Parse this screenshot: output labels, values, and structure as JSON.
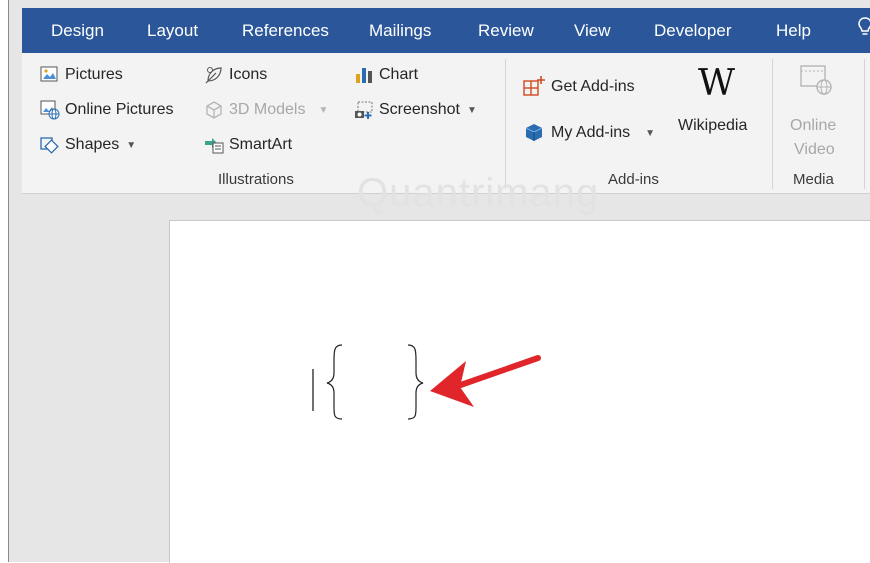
{
  "tabs": [
    "Design",
    "Layout",
    "References",
    "Mailings",
    "Review",
    "View",
    "Developer",
    "Help"
  ],
  "tab_icons": {
    "tell_me": "lightbulb-icon"
  },
  "illustrations": {
    "pictures": "Pictures",
    "online_pictures": "Online Pictures",
    "shapes": "Shapes",
    "icons": "Icons",
    "models_3d": "3D Models",
    "smartart": "SmartArt",
    "chart": "Chart",
    "screenshot": "Screenshot",
    "group_label": "Illustrations"
  },
  "addins": {
    "get_addins": "Get Add-ins",
    "my_addins": "My Add-ins",
    "wikipedia": "Wikipedia",
    "wikipedia_logo": "W",
    "group_label": "Add-ins"
  },
  "media": {
    "online_video_line1": "Online",
    "online_video_line2": "Video",
    "group_label": "Media"
  },
  "watermark": "Quantrimang",
  "colors": {
    "tabbar": "#2b579a",
    "ribbon": "#f3f3f3",
    "arrow": "#e0262a"
  }
}
